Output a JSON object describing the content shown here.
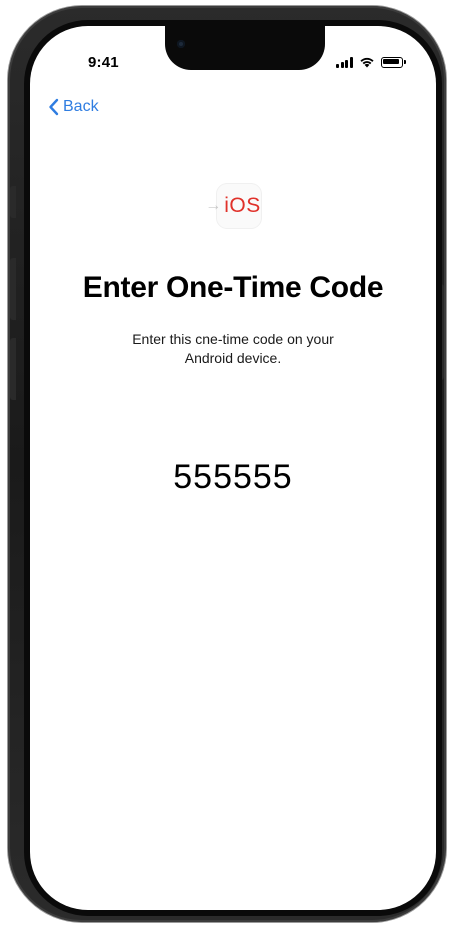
{
  "status_bar": {
    "time": "9:41",
    "icons": [
      "cellular-signal-icon",
      "wifi-icon",
      "battery-icon"
    ]
  },
  "nav": {
    "back_label": "Back",
    "back_icon": "chevron-left-icon"
  },
  "app_icon": {
    "arrow": "→",
    "label": "iOS",
    "label_color": "#e0312a"
  },
  "main": {
    "title": "Enter One-Time Code",
    "instructions_line1": "Enter this cne-time code on your",
    "instructions_line2": "Android device.",
    "code": "555555"
  },
  "colors": {
    "accent": "#2f7de1",
    "text": "#000000",
    "background": "#ffffff"
  }
}
